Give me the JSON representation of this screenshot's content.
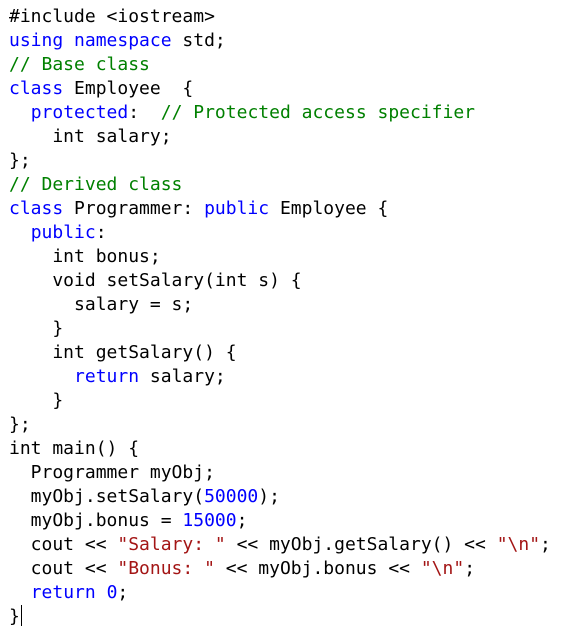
{
  "editor": {
    "lines": [
      [
        {
          "t": "#include <iostream>",
          "k": "plain"
        }
      ],
      [
        {
          "t": "using",
          "k": "keyword"
        },
        {
          "t": " ",
          "k": "plain"
        },
        {
          "t": "namespace",
          "k": "keyword"
        },
        {
          "t": " std;",
          "k": "plain"
        }
      ],
      [
        {
          "t": "// Base class",
          "k": "comment"
        }
      ],
      [
        {
          "t": "class",
          "k": "keyword"
        },
        {
          "t": " Employee  {",
          "k": "plain"
        }
      ],
      [
        {
          "t": "  ",
          "k": "plain"
        },
        {
          "t": "protected",
          "k": "keyword"
        },
        {
          "t": ":  ",
          "k": "plain"
        },
        {
          "t": "// Protected access specifier",
          "k": "comment"
        }
      ],
      [
        {
          "t": "    int salary;",
          "k": "plain"
        }
      ],
      [
        {
          "t": "};",
          "k": "plain"
        }
      ],
      [
        {
          "t": "// Derived class",
          "k": "comment"
        }
      ],
      [
        {
          "t": "class",
          "k": "keyword"
        },
        {
          "t": " Programmer: ",
          "k": "plain"
        },
        {
          "t": "public",
          "k": "keyword"
        },
        {
          "t": " Employee {",
          "k": "plain"
        }
      ],
      [
        {
          "t": "  ",
          "k": "plain"
        },
        {
          "t": "public",
          "k": "keyword"
        },
        {
          "t": ":",
          "k": "plain"
        }
      ],
      [
        {
          "t": "    int bonus;",
          "k": "plain"
        }
      ],
      [
        {
          "t": "    void setSalary(int s) {",
          "k": "plain"
        }
      ],
      [
        {
          "t": "      salary = s;",
          "k": "plain"
        }
      ],
      [
        {
          "t": "    }",
          "k": "plain"
        }
      ],
      [
        {
          "t": "    int getSalary() {",
          "k": "plain"
        }
      ],
      [
        {
          "t": "      ",
          "k": "plain"
        },
        {
          "t": "return",
          "k": "keyword"
        },
        {
          "t": " salary;",
          "k": "plain"
        }
      ],
      [
        {
          "t": "    }",
          "k": "plain"
        }
      ],
      [
        {
          "t": "};",
          "k": "plain"
        }
      ],
      [
        {
          "t": "int main() {",
          "k": "plain"
        }
      ],
      [
        {
          "t": "  Programmer myObj;",
          "k": "plain"
        }
      ],
      [
        {
          "t": "  myObj.setSalary(",
          "k": "plain"
        },
        {
          "t": "50000",
          "k": "number"
        },
        {
          "t": ");",
          "k": "plain"
        }
      ],
      [
        {
          "t": "  myObj.bonus = ",
          "k": "plain"
        },
        {
          "t": "15000",
          "k": "number"
        },
        {
          "t": ";",
          "k": "plain"
        }
      ],
      [
        {
          "t": "  cout << ",
          "k": "plain"
        },
        {
          "t": "\"Salary: \"",
          "k": "string"
        },
        {
          "t": " << myObj.getSalary() << ",
          "k": "plain"
        },
        {
          "t": "\"\\n\"",
          "k": "string"
        },
        {
          "t": ";",
          "k": "plain"
        }
      ],
      [
        {
          "t": "  cout << ",
          "k": "plain"
        },
        {
          "t": "\"Bonus: \"",
          "k": "string"
        },
        {
          "t": " << myObj.bonus << ",
          "k": "plain"
        },
        {
          "t": "\"\\n\"",
          "k": "string"
        },
        {
          "t": ";",
          "k": "plain"
        }
      ],
      [
        {
          "t": "  ",
          "k": "plain"
        },
        {
          "t": "return",
          "k": "keyword"
        },
        {
          "t": " ",
          "k": "plain"
        },
        {
          "t": "0",
          "k": "number"
        },
        {
          "t": ";",
          "k": "plain"
        }
      ],
      [
        {
          "t": "}",
          "k": "plain"
        }
      ]
    ],
    "caret_line": 25
  },
  "colors": {
    "plain": "#000000",
    "keyword": "#0000ff",
    "comment": "#008000",
    "string": "#a31515",
    "number": "#0000ff",
    "background": "#ffffff"
  }
}
